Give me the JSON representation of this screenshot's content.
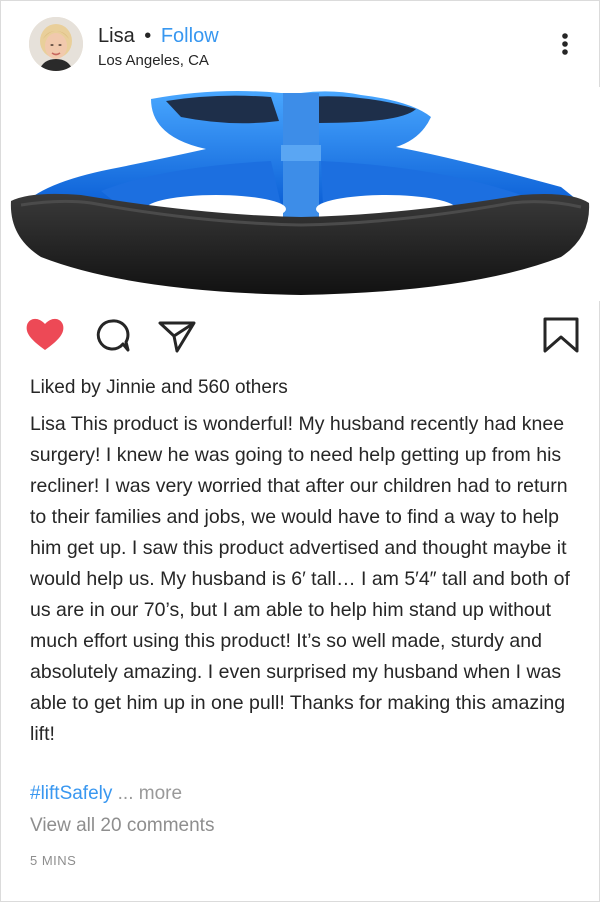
{
  "header": {
    "username": "Lisa",
    "separator": "•",
    "follow_label": "Follow",
    "location": "Los Angeles, CA"
  },
  "photo": {
    "description_icon": "walker-base-product-image"
  },
  "actions": {
    "like_icon": "heart-filled-icon",
    "like_color": "#ed4956",
    "comment_icon": "comment-bubble-icon",
    "share_icon": "paper-plane-icon",
    "save_icon": "bookmark-icon"
  },
  "likes": {
    "prefix": "Liked by",
    "user": "Jinnie",
    "connector": "and",
    "others": "560 others"
  },
  "caption": {
    "username": "Lisa",
    "text": "This product is wonderful! My husband recently had knee surgery! I knew he was going to need help getting up from his recliner! I was very worried that after our children had to return to their families and jobs, we would have to find a way to help him get up. I saw this product advertised and thought maybe it would help us. My husband is 6′ tall… I am 5′4″ tall and both of us are in our 70’s, but I am able to help him stand up without much effort using this product! It’s so well made, sturdy and absolutely amazing. I even surprised my husband when I was able to get him up in one pull! Thanks for making this amazing lift!",
    "hashtag": "#liftSafely",
    "more_label": "... more"
  },
  "comments_label": "View all 20 comments",
  "timestamp": "5 MINS",
  "colors": {
    "link_blue": "#3897f0",
    "muted_gray": "#8e8e8e",
    "text": "#262626"
  }
}
